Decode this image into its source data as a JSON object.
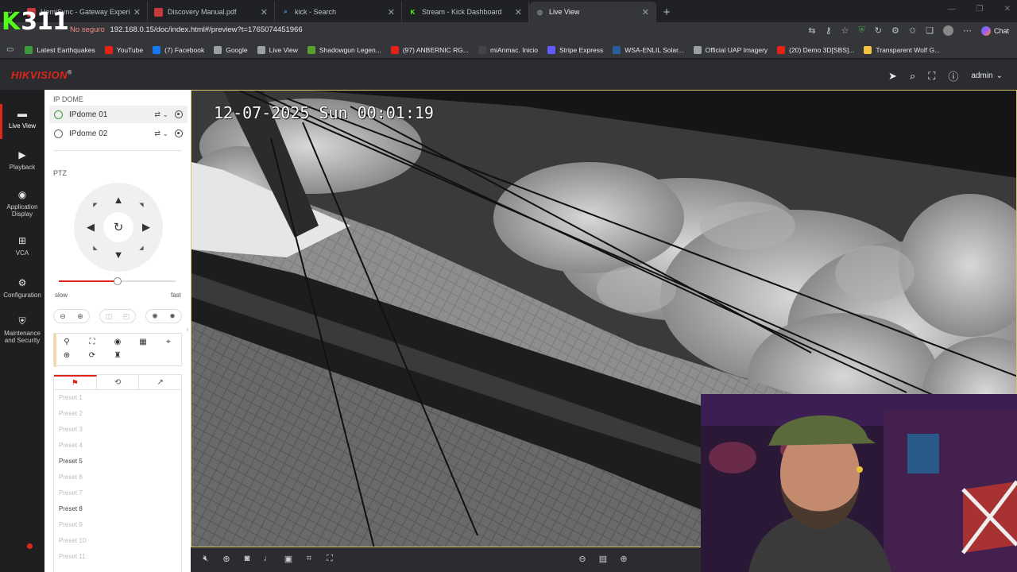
{
  "browser": {
    "tabs": [
      {
        "title": "HemiSync - Gateway Experience -",
        "fav_color": "#c73a3a",
        "fav_glyph": ""
      },
      {
        "title": "Discovery Manual.pdf",
        "fav_color": "#c73a3a",
        "fav_glyph": ""
      },
      {
        "title": "kick - Search",
        "fav_color": "#4d8df7",
        "fav_glyph": "⌕"
      },
      {
        "title": "Stream - Kick Dashboard",
        "fav_color": "#53fc18",
        "fav_glyph": "K"
      },
      {
        "title": "Live View",
        "fav_color": "#9aa0a6",
        "fav_glyph": "◎"
      }
    ],
    "active_tab": 4,
    "address": {
      "security": "No seguro",
      "url": "192.168.0.15/doc/index.html#/preview?t=1765074451966"
    },
    "chat_label": "Chat",
    "bookmarks": [
      {
        "label": "Latest Earthquakes",
        "color": "#3c9a3c"
      },
      {
        "label": "YouTube",
        "color": "#e62117"
      },
      {
        "label": "(7) Facebook",
        "color": "#1877f2"
      },
      {
        "label": "Google",
        "color": "#9aa0a6"
      },
      {
        "label": "Live View",
        "color": "#9aa0a6"
      },
      {
        "label": "Shadowgun Legen...",
        "color": "#5aa02c"
      },
      {
        "label": "(97) ANBERNIC RG...",
        "color": "#e62117"
      },
      {
        "label": "miAnmac. Inicio",
        "color": "#444"
      },
      {
        "label": "Stripe Express",
        "color": "#635bff"
      },
      {
        "label": "WSA-ENLIL Solar...",
        "color": "#2a5d9e"
      },
      {
        "label": "Official UAP Imagery",
        "color": "#9aa0a6"
      },
      {
        "label": "(20) Demo 3D[SBS]...",
        "color": "#e62117"
      },
      {
        "label": "Transparent Wolf G...",
        "color": "#f5c542"
      }
    ]
  },
  "stream_overlay": {
    "viewers": "311"
  },
  "header": {
    "logo": "HIKVISION",
    "logo_mark": "®",
    "user": "admin"
  },
  "nav": [
    {
      "label": "Live View",
      "icon": "monitor-icon"
    },
    {
      "label": "Playback",
      "icon": "playback-icon"
    },
    {
      "label": "Application Display",
      "icon": "application-icon"
    },
    {
      "label": "VCA",
      "icon": "vca-icon"
    },
    {
      "label": "Configuration",
      "icon": "gear-icon"
    },
    {
      "label": "Maintenance and Security",
      "icon": "maintenance-icon"
    }
  ],
  "cameras": {
    "section_title": "IP DOME",
    "items": [
      {
        "name": "IPdome 01",
        "selected": true
      },
      {
        "name": "IPdome 02",
        "selected": false
      }
    ]
  },
  "ptz": {
    "title": "PTZ",
    "speed": 0.5,
    "slow_label": "slow",
    "fast_label": "fast"
  },
  "presets": [
    {
      "label": "Preset 1",
      "set": false
    },
    {
      "label": "Preset 2",
      "set": false
    },
    {
      "label": "Preset 3",
      "set": false
    },
    {
      "label": "Preset 4",
      "set": false
    },
    {
      "label": "Preset 5",
      "set": true
    },
    {
      "label": "Preset 6",
      "set": false
    },
    {
      "label": "Preset 7",
      "set": false
    },
    {
      "label": "Preset 8",
      "set": true
    },
    {
      "label": "Preset 9",
      "set": false
    },
    {
      "label": "Preset 10",
      "set": false
    },
    {
      "label": "Preset 11",
      "set": false
    }
  ],
  "video": {
    "osd": "12-07-2025 Sun 00:01:19"
  }
}
